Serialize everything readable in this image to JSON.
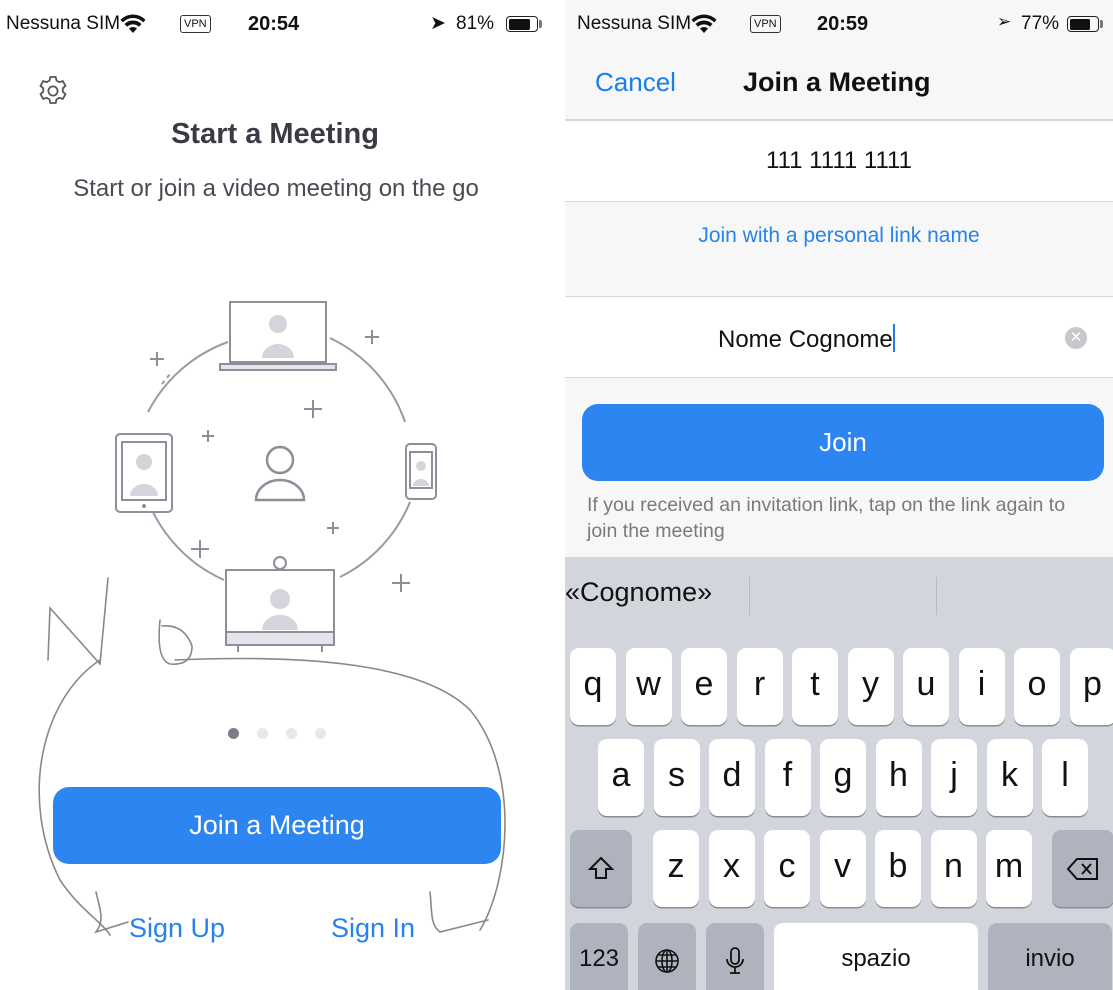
{
  "left_screen": {
    "status_bar": {
      "carrier": "Nessuna SIM",
      "vpn": "VPN",
      "time": "20:54",
      "location_icon": "location-arrow-icon",
      "battery": "81%",
      "battery_level": 0.81
    },
    "settings_icon": "gear-icon",
    "title": "Start a Meeting",
    "subtitle": "Start or join a video meeting on the go",
    "illustration": "devices-in-meeting-circle",
    "page_dots": {
      "count": 4,
      "active_index": 0
    },
    "join_button": "Join a Meeting",
    "sign_up": "Sign Up",
    "sign_in": "Sign In",
    "handwritten_annotation": "No"
  },
  "right_screen": {
    "status_bar": {
      "carrier": "Nessuna SIM",
      "vpn": "VPN",
      "time": "20:59",
      "location_icon": "location-outline-icon",
      "battery": "77%",
      "battery_level": 0.77
    },
    "nav": {
      "cancel": "Cancel",
      "title": "Join a Meeting"
    },
    "meeting_id": "111 1111 1111",
    "personal_link": "Join with a personal link name",
    "name_field": "Nome Cognome",
    "join_button": "Join",
    "hint": "If you received an invitation link, tap on the link again to join the meeting",
    "keyboard": {
      "suggestion": "«Cognome»",
      "row1": [
        "q",
        "w",
        "e",
        "r",
        "t",
        "y",
        "u",
        "i",
        "o",
        "p"
      ],
      "row2": [
        "a",
        "s",
        "d",
        "f",
        "g",
        "h",
        "j",
        "k",
        "l"
      ],
      "row3": [
        "z",
        "x",
        "c",
        "v",
        "b",
        "n",
        "m"
      ],
      "shift_icon": "shift-arrow-icon",
      "backspace_icon": "backspace-icon",
      "numbers": "123",
      "globe_icon": "globe-icon",
      "mic_icon": "microphone-icon",
      "space": "spazio",
      "return": "invio"
    }
  }
}
